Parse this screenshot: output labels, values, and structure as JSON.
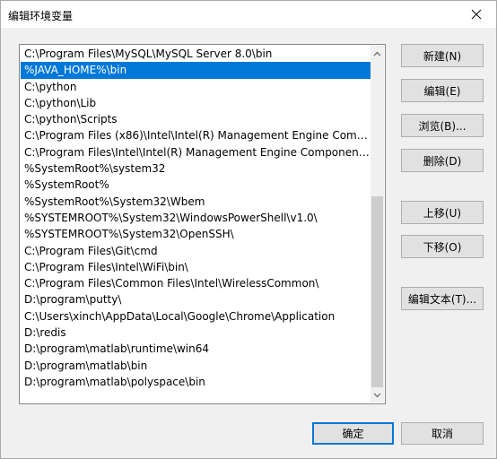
{
  "window": {
    "title": "编辑环境变量"
  },
  "paths": [
    "C:\\Program Files\\MySQL\\MySQL Server 8.0\\bin",
    "%JAVA_HOME%\\bin",
    "C:\\python",
    "C:\\python\\Lib",
    "C:\\python\\Scripts",
    "C:\\Program Files (x86)\\Intel\\Intel(R) Management Engine Compone...",
    "C:\\Program Files\\Intel\\Intel(R) Management Engine Components\\...",
    "%SystemRoot%\\system32",
    "%SystemRoot%",
    "%SystemRoot%\\System32\\Wbem",
    "%SYSTEMROOT%\\System32\\WindowsPowerShell\\v1.0\\",
    "%SYSTEMROOT%\\System32\\OpenSSH\\",
    "C:\\Program Files\\Git\\cmd",
    "C:\\Program Files\\Intel\\WiFi\\bin\\",
    "C:\\Program Files\\Common Files\\Intel\\WirelessCommon\\",
    "D:\\program\\putty\\",
    "C:\\Users\\xinch\\AppData\\Local\\Google\\Chrome\\Application",
    "D:\\redis",
    "D:\\program\\matlab\\runtime\\win64",
    "D:\\program\\matlab\\bin",
    "D:\\program\\matlab\\polyspace\\bin"
  ],
  "selected_path": "%JAVA_HOME%\\bin",
  "buttons": {
    "new": "新建(N)",
    "edit": "编辑(E)",
    "browse": "浏览(B)...",
    "delete": "删除(D)",
    "move_up": "上移(U)",
    "move_down": "下移(O)",
    "edit_text": "编辑文本(T)...",
    "ok": "确定",
    "cancel": "取消"
  },
  "colors": {
    "selection": "#0078d7",
    "default_button_border": "#0078d7"
  }
}
